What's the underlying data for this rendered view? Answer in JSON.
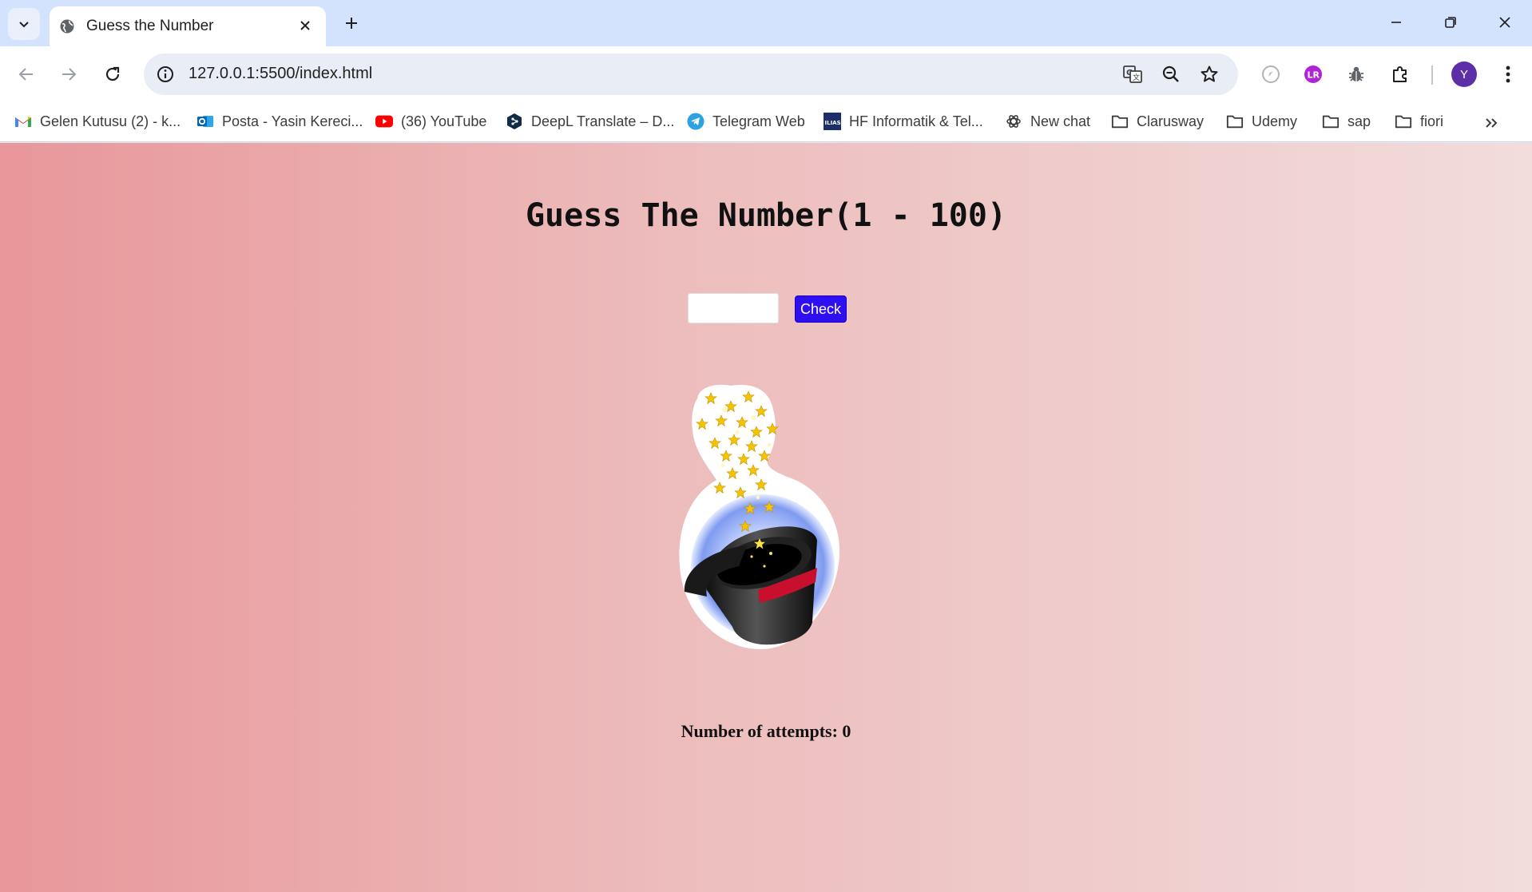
{
  "browser": {
    "tab_title": "Guess the Number",
    "url": "127.0.0.1:5500/index.html",
    "profile_initial": "Y",
    "bookmarks": [
      {
        "label": "Gelen Kutusu (2) - k...",
        "icon": "gmail-icon"
      },
      {
        "label": "Posta - Yasin Kereci...",
        "icon": "outlook-icon"
      },
      {
        "label": "(36) YouTube",
        "icon": "youtube-icon"
      },
      {
        "label": "DeepL Translate – D...",
        "icon": "deepl-icon"
      },
      {
        "label": "Telegram Web",
        "icon": "telegram-icon"
      },
      {
        "label": "HF Informatik & Tel...",
        "icon": "ilias-icon"
      },
      {
        "label": "New chat",
        "icon": "chatgpt-icon"
      },
      {
        "label": "Clarusway",
        "icon": "folder-icon"
      },
      {
        "label": "Udemy",
        "icon": "folder-icon"
      },
      {
        "label": "sap",
        "icon": "folder-icon"
      },
      {
        "label": "fiori",
        "icon": "folder-icon"
      }
    ],
    "colors": {
      "accent": "#d3e3fd",
      "avatar": "#5c2fa8"
    }
  },
  "page": {
    "title": "Guess The Number(1 - 100)",
    "input_value": "",
    "check_label": "Check",
    "attempts_label": "Number of attempts: 0",
    "image_icon": "magic-hat-icon",
    "colors": {
      "button": "#2d0ff2",
      "bg_start": "#e8979a",
      "bg_end": "#f2dcdc"
    }
  }
}
